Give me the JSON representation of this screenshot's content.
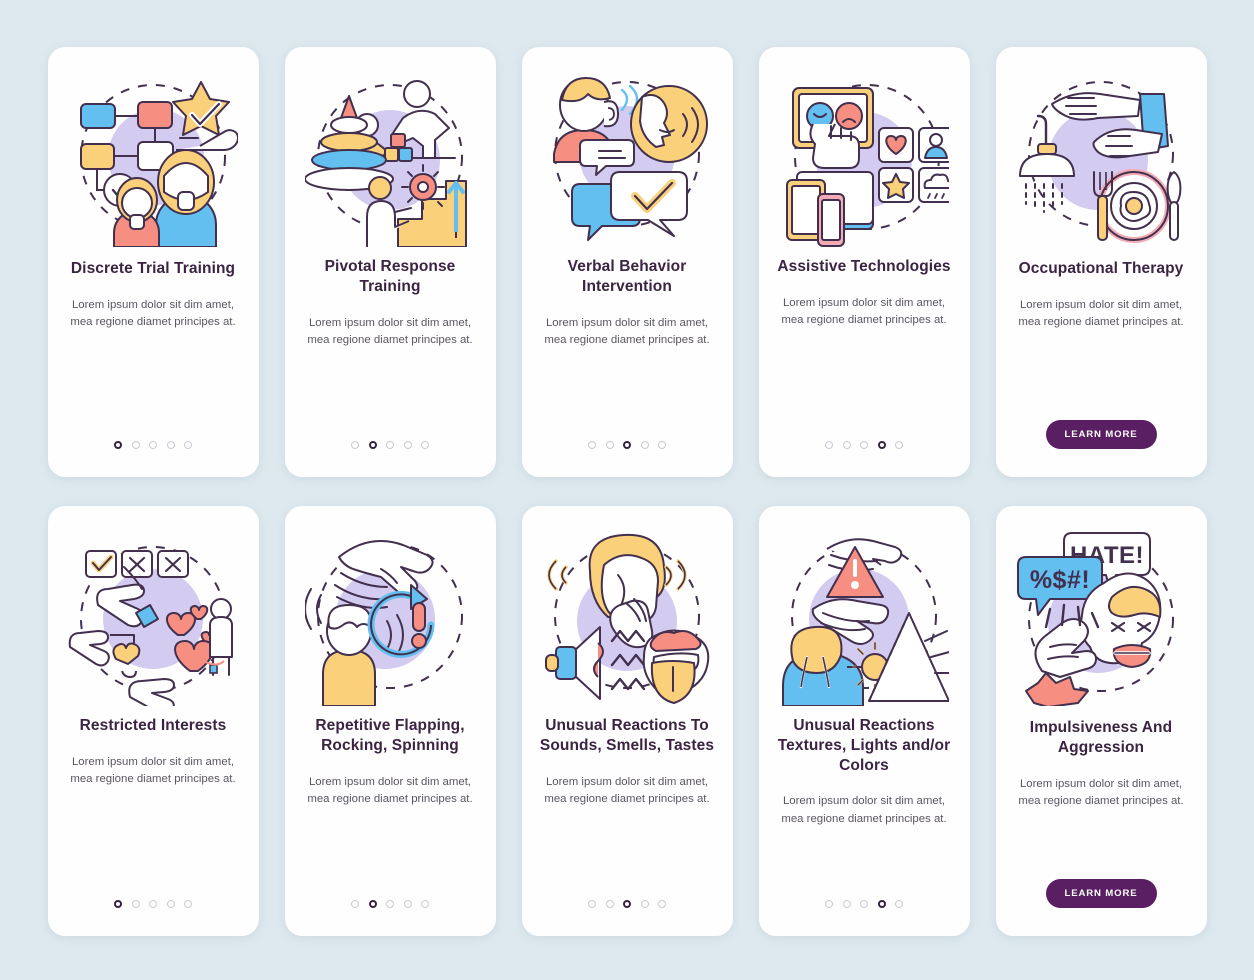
{
  "page": {
    "background_color": "#dde9ee",
    "card_background": "#fefeff",
    "title_color": "#3b2441",
    "body_color": "#5b5560",
    "accent_color": "#5a1f63",
    "dot_active_color": "#352140",
    "dot_inactive_color": "#cdc9d2"
  },
  "shared": {
    "body_text": "Lorem ipsum dolor sit dim amet, mea regione diamet principes at.",
    "learn_more_label": "LEARN MORE",
    "dot_count": 5
  },
  "rows": [
    {
      "cards": [
        {
          "title": "Discrete Trial Training",
          "icon_name": "flowchart-star-family-illustration",
          "body_text": "Lorem ipsum dolor sit dim amet, mea regione diamet principes at.",
          "footer_type": "dots",
          "active_dot": 1
        },
        {
          "title": "Pivotal Response Training",
          "icon_name": "stacking-rings-play-stairs-illustration",
          "body_text": "Lorem ipsum dolor sit dim amet, mea regione diamet principes at.",
          "footer_type": "dots",
          "active_dot": 2
        },
        {
          "title": "Verbal Behavior Intervention",
          "icon_name": "speech-listening-bubbles-illustration",
          "body_text": "Lorem ipsum dolor sit dim amet, mea regione diamet principes at.",
          "footer_type": "dots",
          "active_dot": 3
        },
        {
          "title": "Assistive Technologies",
          "icon_name": "tablet-devices-picture-cards-illustration",
          "body_text": "Lorem ipsum dolor sit dim amet, mea regione diamet principes at.",
          "footer_type": "dots",
          "active_dot": 4
        },
        {
          "title": "Occupational Therapy",
          "icon_name": "hands-towel-shower-plate-illustration",
          "body_text": "Lorem ipsum dolor sit dim amet, mea regione diamet principes at.",
          "footer_type": "button",
          "button_label": "LEARN MORE"
        }
      ]
    },
    {
      "cards": [
        {
          "title": "Restricted Interests",
          "icon_name": "checkboxes-hand-hearts-person-illustration",
          "body_text": "Lorem ipsum dolor sit dim amet, mea regione diamet principes at.",
          "footer_type": "dots",
          "active_dot": 1
        },
        {
          "title": "Repetitive Flapping, Rocking, Spinning",
          "icon_name": "flapping-hand-rocking-person-loop-illustration",
          "body_text": "Lorem ipsum dolor sit dim amet, mea regione diamet principes at.",
          "footer_type": "dots",
          "active_dot": 2
        },
        {
          "title": "Unusual Reactions To Sounds, Smells, Tastes",
          "icon_name": "megaphone-nose-tongue-illustration",
          "body_text": "Lorem ipsum dolor sit dim amet, mea regione diamet principes at.",
          "footer_type": "dots",
          "active_dot": 3
        },
        {
          "title": "Unusual Reactions Textures, Lights and/or Colors",
          "icon_name": "warning-triangle-prism-light-illustration",
          "body_text": "Lorem ipsum dolor sit dim amet, mea regione diamet principes at.",
          "footer_type": "dots",
          "active_dot": 4
        },
        {
          "title": "Impulsiveness And Aggression",
          "icon_name": "hate-speech-bubble-angry-face-fist-illustration",
          "body_text": "Lorem ipsum dolor sit dim amet, mea regione diamet principes at.",
          "footer_type": "button",
          "button_label": "LEARN MORE"
        }
      ]
    }
  ],
  "illustration_palette": {
    "outline": "#42304e",
    "lavender": "#d3cbf0",
    "yellow": "#fbd07a",
    "blue": "#62bff0",
    "coral": "#f78e82",
    "white": "#ffffff",
    "pink": "#f2aab5"
  }
}
